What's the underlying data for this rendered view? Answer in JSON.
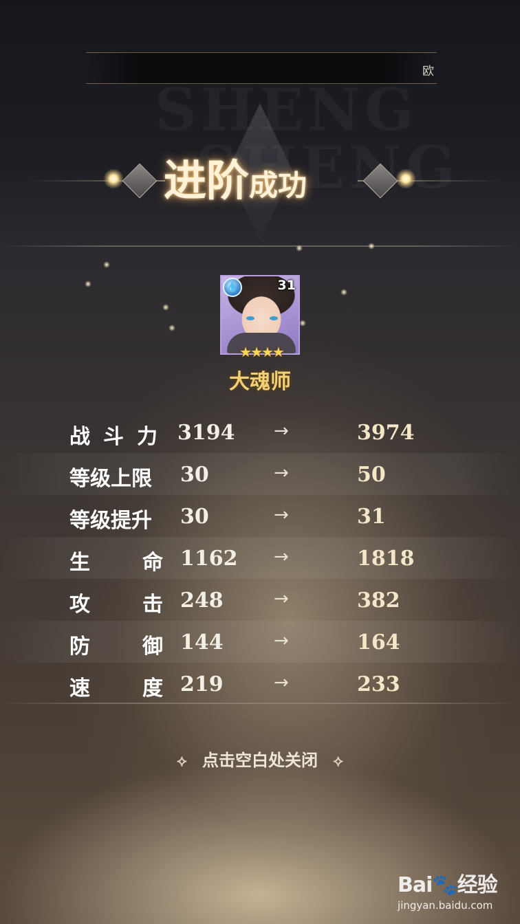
{
  "top_bar": {
    "text": "欧"
  },
  "background_watermark": [
    "SHENG",
    "SHENG"
  ],
  "title": {
    "main": "进阶",
    "sub": "成功"
  },
  "hero": {
    "level": "31",
    "element_icon": "water-drop-icon",
    "stars": 4,
    "stars_text": "★★★★",
    "name": "大魂师"
  },
  "stats": [
    {
      "label_parts": [
        "战",
        "斗",
        "力"
      ],
      "old": "3194",
      "arrow": "→",
      "new": "3974"
    },
    {
      "label_parts": [
        "等级上限"
      ],
      "old": "30",
      "arrow": "→",
      "new": "50"
    },
    {
      "label_parts": [
        "等级提升"
      ],
      "old": "30",
      "arrow": "→",
      "new": "31"
    },
    {
      "label_parts": [
        "生",
        "命"
      ],
      "old": "1162",
      "arrow": "→",
      "new": "1818"
    },
    {
      "label_parts": [
        "攻",
        "击"
      ],
      "old": "248",
      "arrow": "→",
      "new": "382"
    },
    {
      "label_parts": [
        "防",
        "御"
      ],
      "old": "144",
      "arrow": "→",
      "new": "164"
    },
    {
      "label_parts": [
        "速",
        "度"
      ],
      "old": "219",
      "arrow": "→",
      "new": "233"
    }
  ],
  "close_hint": {
    "text": "点击空白处关闭",
    "left_ornament": "⟡",
    "right_ornament": "⟡"
  },
  "watermark": {
    "logo": "Bai🐾经验",
    "url": "jingyan.baidu.com"
  },
  "colors": {
    "title_glow": "#ffbe64",
    "hero_name": "#f2cf79",
    "stat_text": "#ffffff",
    "stars": "#ffd45a"
  }
}
